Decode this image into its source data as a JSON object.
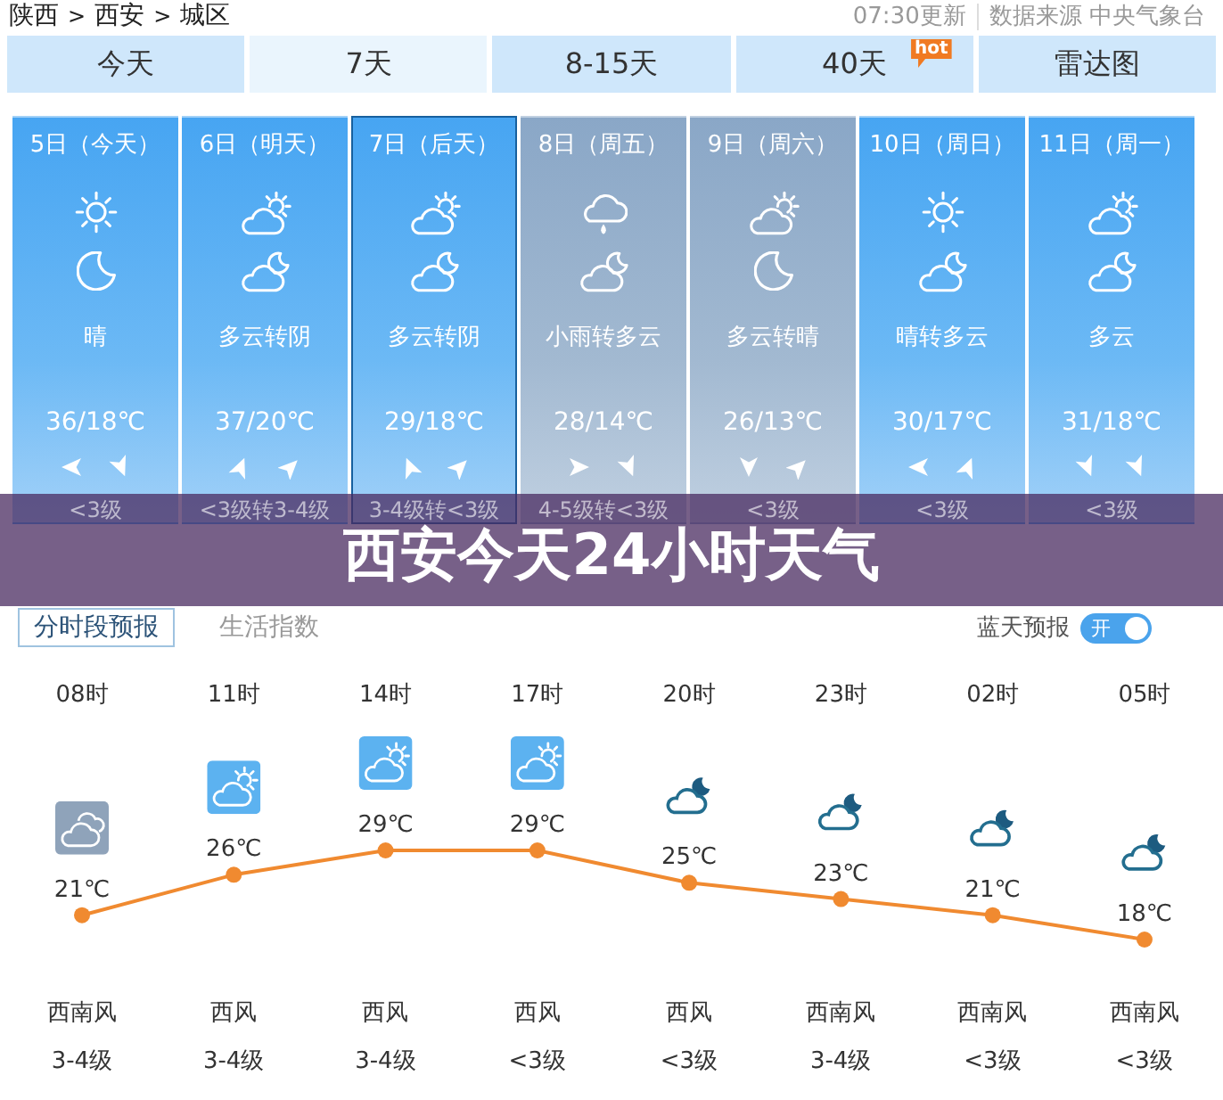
{
  "breadcrumb": [
    {
      "kind": "link",
      "text": "陕西"
    },
    {
      "kind": "separator",
      "text": ">"
    },
    {
      "kind": "link",
      "text": "西安"
    },
    {
      "kind": "separator",
      "text": ">"
    },
    {
      "kind": "link",
      "text": "城区"
    }
  ],
  "update_time": "07:30更新",
  "source": "数据来源 中央气象台",
  "tabs": [
    {
      "label": "今天",
      "selected": false
    },
    {
      "label": "7天",
      "selected": true
    },
    {
      "label": "8-15天",
      "selected": false
    },
    {
      "label": "40天",
      "selected": false,
      "badge": "hot"
    },
    {
      "label": "雷达图",
      "selected": false
    }
  ],
  "days": [
    {
      "date": "5日（今天）",
      "kind": "clear",
      "selected": false,
      "icons": [
        {
          "kind": "sun"
        },
        {
          "kind": "moon"
        }
      ],
      "condition": "晴",
      "temperature": "36/18℃",
      "winds": [
        {
          "kind": "w"
        },
        {
          "kind": "sse"
        }
      ],
      "wind_force": "<3级"
    },
    {
      "date": "6日（明天）",
      "kind": "clear",
      "selected": false,
      "icons": [
        {
          "kind": "suncloud"
        },
        {
          "kind": "mooncloud"
        }
      ],
      "condition": "多云转阴",
      "temperature": "37/20℃",
      "winds": [
        {
          "kind": "nne"
        },
        {
          "kind": "ne"
        }
      ],
      "wind_force": "<3级转3-4级"
    },
    {
      "date": "7日（后天）",
      "kind": "clear",
      "selected": true,
      "icons": [
        {
          "kind": "suncloud"
        },
        {
          "kind": "mooncloud"
        }
      ],
      "condition": "多云转阴",
      "temperature": "29/18℃",
      "winds": [
        {
          "kind": "nnw"
        },
        {
          "kind": "ne"
        }
      ],
      "wind_force": "3-4级转<3级"
    },
    {
      "date": "8日（周五）",
      "kind": "overcast",
      "selected": false,
      "icons": [
        {
          "kind": "rain"
        },
        {
          "kind": "mooncloud"
        }
      ],
      "condition": "小雨转多云",
      "temperature": "28/14℃",
      "winds": [
        {
          "kind": "e"
        },
        {
          "kind": "sse"
        }
      ],
      "wind_force": "4-5级转<3级"
    },
    {
      "date": "9日（周六）",
      "kind": "overcast",
      "selected": false,
      "icons": [
        {
          "kind": "suncloud"
        },
        {
          "kind": "moon"
        }
      ],
      "condition": "多云转晴",
      "temperature": "26/13℃",
      "winds": [
        {
          "kind": "s"
        },
        {
          "kind": "ne"
        }
      ],
      "wind_force": "<3级"
    },
    {
      "date": "10日（周日）",
      "kind": "clear",
      "selected": false,
      "icons": [
        {
          "kind": "sun"
        },
        {
          "kind": "mooncloud"
        }
      ],
      "condition": "晴转多云",
      "temperature": "30/17℃",
      "winds": [
        {
          "kind": "w"
        },
        {
          "kind": "nne"
        }
      ],
      "wind_force": "<3级"
    },
    {
      "date": "11日（周一）",
      "kind": "clear",
      "selected": false,
      "icons": [
        {
          "kind": "suncloud"
        },
        {
          "kind": "mooncloud"
        }
      ],
      "condition": "多云",
      "temperature": "31/18℃",
      "winds": [
        {
          "kind": "sse"
        },
        {
          "kind": "sse"
        }
      ],
      "wind_force": "<3级"
    }
  ],
  "banner": {
    "title": "西安今天24小时天气"
  },
  "section_tabs": [
    {
      "label": "分时段预报",
      "selected": true
    },
    {
      "label": "生活指数",
      "selected": false
    }
  ],
  "blue_sky": {
    "label": "蓝天预报",
    "toggle": {
      "on": true,
      "text": "开"
    }
  },
  "hourly": {
    "chart_data": {
      "type": "line",
      "categories": [
        "08时",
        "11时",
        "14时",
        "17时",
        "20时",
        "23时",
        "02时",
        "05时"
      ],
      "series": [
        {
          "color": "#f08a30",
          "marker": "circle",
          "values": [
            21,
            26,
            29,
            29,
            25,
            23,
            21,
            18
          ],
          "value_labels": [
            "21℃",
            "26℃",
            "29℃",
            "29℃",
            "25℃",
            "23℃",
            "21℃",
            "18℃"
          ]
        }
      ]
    },
    "hours": [
      {
        "kind": "overcast",
        "wind_direction": "西南风",
        "wind_force": "3-4级"
      },
      {
        "kind": "cloudy",
        "wind_direction": "西风",
        "wind_force": "3-4级"
      },
      {
        "kind": "cloudy",
        "wind_direction": "西风",
        "wind_force": "3-4级"
      },
      {
        "kind": "cloudy",
        "wind_direction": "西风",
        "wind_force": "<3级"
      },
      {
        "kind": "night",
        "wind_direction": "西风",
        "wind_force": "<3级"
      },
      {
        "kind": "night",
        "wind_direction": "西南风",
        "wind_force": "3-4级"
      },
      {
        "kind": "night",
        "wind_direction": "西南风",
        "wind_force": "<3级"
      },
      {
        "kind": "night",
        "wind_direction": "西南风",
        "wind_force": "<3级"
      }
    ]
  }
}
